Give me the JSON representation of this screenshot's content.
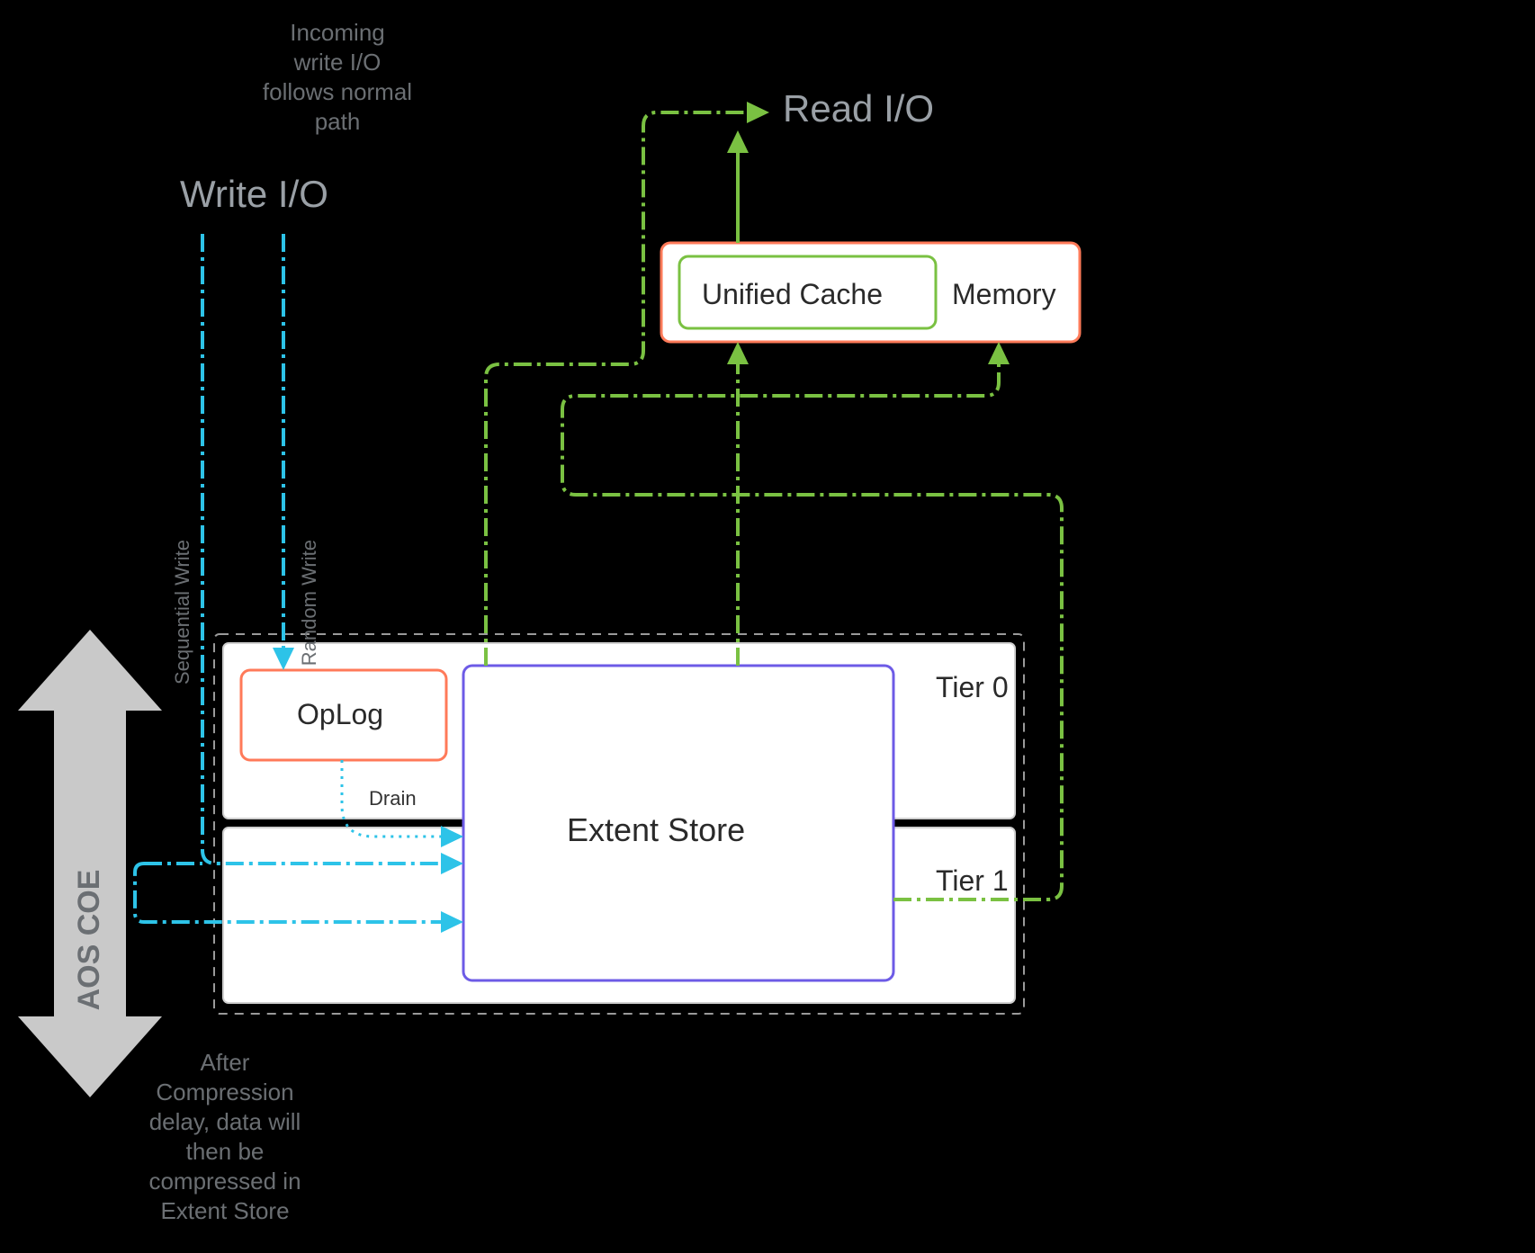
{
  "titles": {
    "write_io": "Write I/O",
    "read_io": "Read I/O"
  },
  "notes": {
    "incoming_l1": "Incoming",
    "incoming_l2": "write I/O",
    "incoming_l3": "follows normal",
    "incoming_l4": "path",
    "after_l1": "After",
    "after_l2": "Compression",
    "after_l3": "delay, data will",
    "after_l4": "then be",
    "after_l5": "compressed in",
    "after_l6": "Extent Store"
  },
  "vertical": {
    "sequential_write": "Sequential Write",
    "random_write": "Random Write",
    "aos_coe": "AOS COE"
  },
  "boxes": {
    "unified_cache": "Unified Cache",
    "memory": "Memory",
    "oplog": "OpLog",
    "extent_store": "Extent Store",
    "tier0": "Tier 0",
    "tier1": "Tier 1",
    "drain": "Drain"
  },
  "colors": {
    "cyan": "#2dc3e8",
    "green": "#7ac142",
    "orange": "#ff7a59",
    "purple": "#6d5be6",
    "grey": "#c9c9c9"
  }
}
